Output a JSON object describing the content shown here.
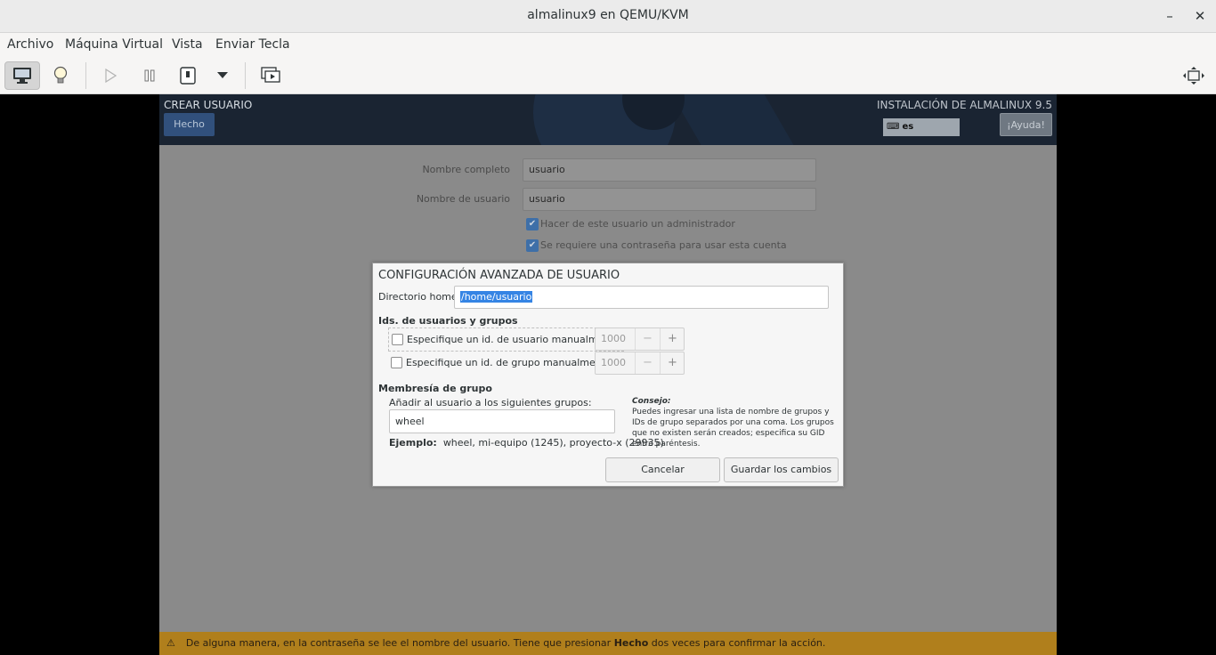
{
  "window": {
    "title": "almalinux9 en QEMU/KVM",
    "minimize_glyph": "–",
    "close_glyph": "✕"
  },
  "menu": {
    "items": [
      "Archivo",
      "Máquina Virtual",
      "Vista",
      "Enviar Tecla"
    ]
  },
  "toolbar": {
    "icons": [
      "monitor-icon",
      "lightbulb-icon",
      "play-icon",
      "pause-icon",
      "power-icon",
      "dropdown-icon",
      "snapshots-icon",
      "fullscreen-icon"
    ]
  },
  "installer": {
    "spoke_title": "CREAR USUARIO",
    "done_label": "Hecho",
    "product_title": "INSTALACIÓN DE ALMALINUX 9.5",
    "keyboard_layout": "es",
    "help_label": "¡Ayuda!",
    "fullname_label": "Nombre completo",
    "fullname_value": "usuario",
    "username_label": "Nombre de usuario",
    "username_value": "usuario",
    "admin_check_label": "Hacer de este usuario un administrador",
    "password_check_label": "Se requiere una contraseña para usar esta cuenta",
    "warning_prefix": "De alguna manera, en la contraseña se lee el nombre del usuario. Tiene que presionar ",
    "warning_bold": "Hecho",
    "warning_suffix": " dos veces para confirmar la acción."
  },
  "dialog": {
    "title": "CONFIGURACIÓN AVANZADA DE USUARIO",
    "home_label": "Directorio home:",
    "home_value": "/home/usuario",
    "ids_heading": "Ids. de usuarios y grupos",
    "uid_check_label": "Especifique un id. de usuario manualmente:",
    "uid_value": "1000",
    "gid_check_label": "Especifique un id. de grupo manualmente:",
    "gid_value": "1000",
    "spin_minus": "−",
    "spin_plus": "+",
    "membership_heading": "Membresía de grupo",
    "groups_label": "Añadir al usuario a los siguientes grupos:",
    "groups_value": "wheel",
    "example_label": "Ejemplo:",
    "example_value": "wheel, mi-equipo (1245), proyecto-x (29935)",
    "tip_heading": "Consejo:",
    "tip_text": "Puedes ingresar una lista de nombre de grupos y IDs de grupo separados por una coma. Los grupos que no existen serán creados; especifica su GID entre paréntesis.",
    "cancel_label": "Cancelar",
    "save_label": "Guardar los cambios"
  }
}
